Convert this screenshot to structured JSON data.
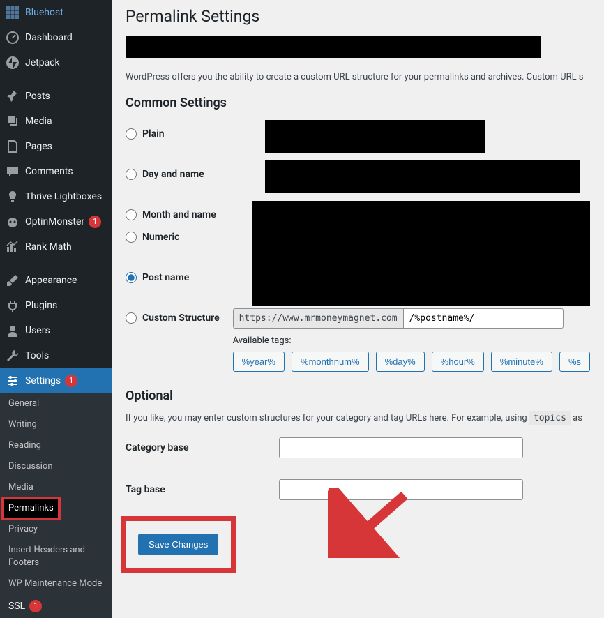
{
  "sidebar": {
    "items": [
      {
        "label": "Bluehost",
        "icon": "grid"
      },
      {
        "label": "Dashboard",
        "icon": "dashboard"
      },
      {
        "label": "Jetpack",
        "icon": "jetpack"
      },
      {
        "label": "Posts",
        "icon": "pin"
      },
      {
        "label": "Media",
        "icon": "media"
      },
      {
        "label": "Pages",
        "icon": "page"
      },
      {
        "label": "Comments",
        "icon": "comment"
      },
      {
        "label": "Thrive Lightboxes",
        "icon": "lamp"
      },
      {
        "label": "OptinMonster",
        "icon": "monster",
        "badge": "1"
      },
      {
        "label": "Rank Math",
        "icon": "chart"
      },
      {
        "label": "Appearance",
        "icon": "brush"
      },
      {
        "label": "Plugins",
        "icon": "plugin"
      },
      {
        "label": "Users",
        "icon": "user"
      },
      {
        "label": "Tools",
        "icon": "wrench"
      },
      {
        "label": "Settings",
        "icon": "sliders",
        "badge": "1",
        "current": true
      }
    ],
    "submenu": [
      "General",
      "Writing",
      "Reading",
      "Discussion",
      "Media",
      "Permalinks",
      "Privacy",
      "Insert Headers and Footers",
      "WP Maintenance Mode"
    ],
    "submenu_current": "Permalinks",
    "ssl": {
      "label": "SSL",
      "badge": "1"
    }
  },
  "page": {
    "title": "Permalink Settings",
    "intro": "WordPress offers you the ability to create a custom URL structure for your permalinks and archives. Custom URL s",
    "common_heading": "Common Settings",
    "options": {
      "plain": "Plain",
      "day_name": "Day and name",
      "month_name": "Month and name",
      "numeric": "Numeric",
      "post_name": "Post name",
      "custom": "Custom Structure"
    },
    "selected": "post_name",
    "custom_base": "https://www.mrmoneymagnet.com",
    "custom_value": "/%postname%/",
    "available_tags_label": "Available tags:",
    "tags": [
      "%year%",
      "%monthnum%",
      "%day%",
      "%hour%",
      "%minute%",
      "%s"
    ],
    "optional_heading": "Optional",
    "optional_desc_pre": "If you like, you may enter custom structures for your category and tag URLs here. For example, using ",
    "optional_desc_code": "topics",
    "optional_desc_post": " as",
    "category_base_label": "Category base",
    "category_base_value": "",
    "tag_base_label": "Tag base",
    "tag_base_value": "",
    "save_label": "Save Changes"
  }
}
